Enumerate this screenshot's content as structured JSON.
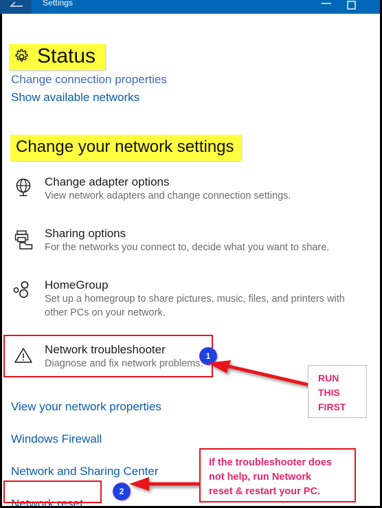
{
  "window": {
    "title": "Settings",
    "back_icon": "back-arrow-icon",
    "minimize_label": "",
    "maximize_label": ""
  },
  "page": {
    "heading": "Status",
    "heading_icon": "gear-icon",
    "occluded_link": "Change connection properties",
    "links_top": [
      {
        "label": "Show available networks"
      }
    ],
    "section_heading": "Change your network settings",
    "settings_rows": [
      {
        "icon": "globe-monitor-icon",
        "title": "Change adapter options",
        "desc": "View network adapters and change connection settings."
      },
      {
        "icon": "printer-share-icon",
        "title": "Sharing options",
        "desc": "For the networks you connect to, decide what you want to share."
      },
      {
        "icon": "homegroup-icon",
        "title": "HomeGroup",
        "desc": "Set up a homegroup to share pictures, music, files, and printers with other PCs on your network."
      },
      {
        "icon": "warning-triangle-icon",
        "title": "Network troubleshooter",
        "desc": "Diagnose and fix network problems."
      }
    ],
    "links_bottom": [
      {
        "label": "View your network properties"
      },
      {
        "label": "Windows Firewall"
      },
      {
        "label": "Network and Sharing Center"
      },
      {
        "label": "Network reset"
      }
    ]
  },
  "annotations": {
    "badges": [
      {
        "number": "1"
      },
      {
        "number": "2"
      }
    ],
    "callouts": [
      {
        "id": "run-this-first",
        "lines": [
          "RUN",
          "THIS",
          "FIRST"
        ]
      },
      {
        "id": "network-reset-note",
        "lines": [
          "If the troubleshooter does",
          "not help, run Network",
          "reset & restart your PC."
        ]
      }
    ]
  },
  "colors": {
    "titlebar": "#0067b8",
    "link": "#0a5ca8",
    "highlight": "#ffff3f",
    "annotation_red": "#e8121c",
    "annotation_pink": "#e8246c",
    "badge_blue": "#1a44e0",
    "badge_purple": "#8a2be2"
  }
}
